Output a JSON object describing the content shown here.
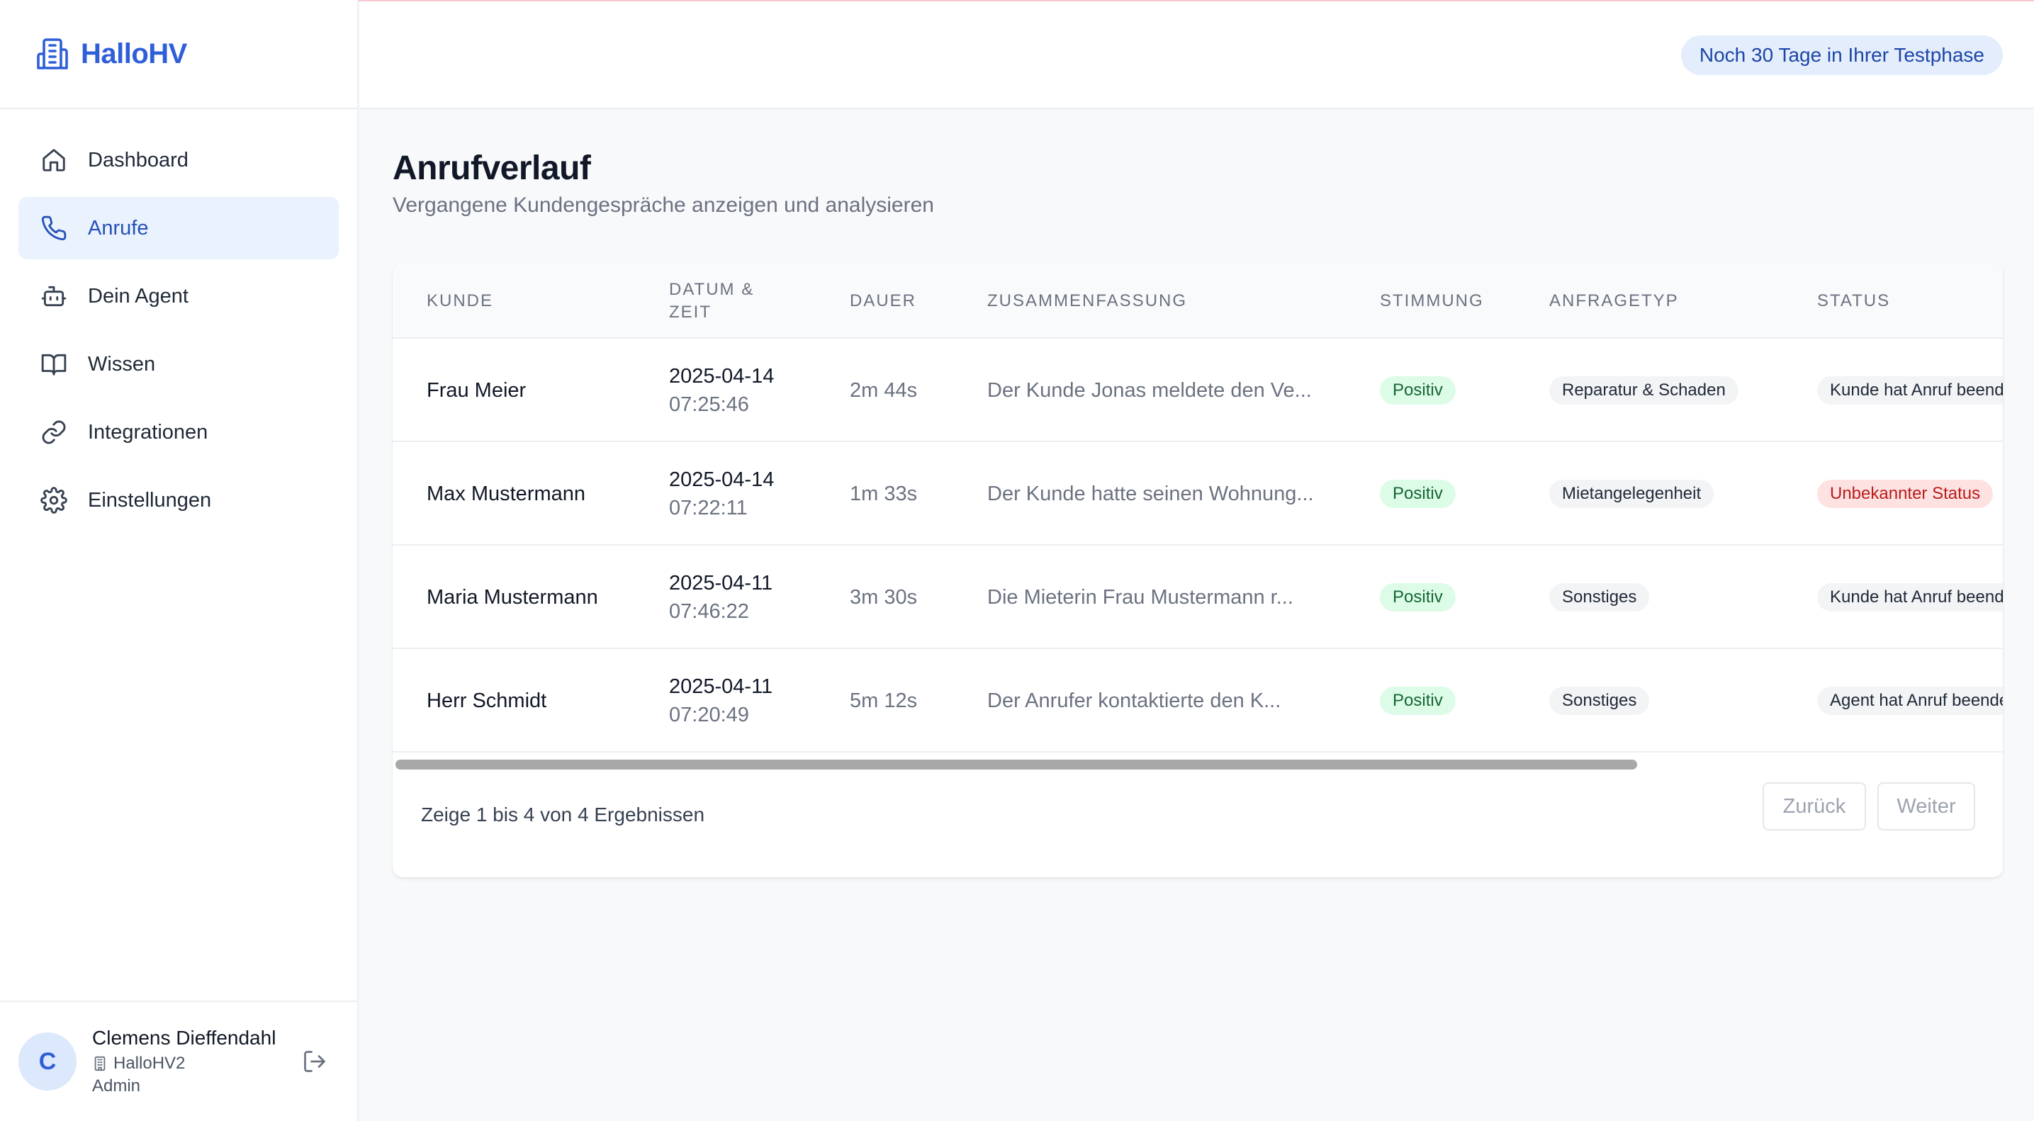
{
  "app": {
    "brand_name": "HalloHV"
  },
  "header": {
    "trial_badge": "Noch 30 Tage in Ihrer Testphase"
  },
  "sidebar": {
    "items": [
      {
        "label": "Dashboard",
        "icon": "home-icon",
        "active": false
      },
      {
        "label": "Anrufe",
        "icon": "phone-icon",
        "active": true
      },
      {
        "label": "Dein Agent",
        "icon": "robot-icon",
        "active": false
      },
      {
        "label": "Wissen",
        "icon": "book-icon",
        "active": false
      },
      {
        "label": "Integrationen",
        "icon": "link-icon",
        "active": false
      },
      {
        "label": "Einstellungen",
        "icon": "gear-icon",
        "active": false
      }
    ],
    "user": {
      "initial": "C",
      "name": "Clemens Dieffendahl",
      "org": "HalloHV2",
      "role": "Admin"
    }
  },
  "page": {
    "title": "Anrufverlauf",
    "subtitle": "Vergangene Kundengespräche anzeigen und analysieren"
  },
  "table": {
    "columns": [
      "KUNDE",
      "DATUM &\nZEIT",
      "DAUER",
      "ZUSAMMENFASSUNG",
      "STIMMUNG",
      "ANFRAGETYP",
      "STATUS"
    ],
    "rows": [
      {
        "kunde": "Frau Meier",
        "datum": "2025-04-14",
        "zeit": "07:25:46",
        "dauer": "2m 44s",
        "summary": "Der Kunde Jonas meldete den Ve...",
        "stimmung": "Positiv",
        "typ": "Reparatur & Schaden",
        "status": "Kunde hat Anruf beendet",
        "status_color": "gray"
      },
      {
        "kunde": "Max Mustermann",
        "datum": "2025-04-14",
        "zeit": "07:22:11",
        "dauer": "1m 33s",
        "summary": "Der Kunde hatte seinen Wohnung...",
        "stimmung": "Positiv",
        "typ": "Mietangelegenheit",
        "status": "Unbekannter Status",
        "status_color": "red"
      },
      {
        "kunde": "Maria Mustermann",
        "datum": "2025-04-11",
        "zeit": "07:46:22",
        "dauer": "3m 30s",
        "summary": "Die Mieterin Frau Mustermann r...",
        "stimmung": "Positiv",
        "typ": "Sonstiges",
        "status": "Kunde hat Anruf beendet",
        "status_color": "gray"
      },
      {
        "kunde": "Herr Schmidt",
        "datum": "2025-04-11",
        "zeit": "07:20:49",
        "dauer": "5m 12s",
        "summary": "Der Anrufer kontaktierte den K...",
        "stimmung": "Positiv",
        "typ": "Sonstiges",
        "status": "Agent hat Anruf beendet",
        "status_color": "gray"
      }
    ]
  },
  "pagination": {
    "results_text": "Zeige 1 bis 4 von 4 Ergebnissen",
    "back_label": "Zurück",
    "next_label": "Weiter"
  },
  "colors": {
    "brand": "#2f5fd8",
    "active_nav_bg": "#eaf2fe",
    "positive": "#dcfce7",
    "unknown_status": "#fee2e2"
  }
}
